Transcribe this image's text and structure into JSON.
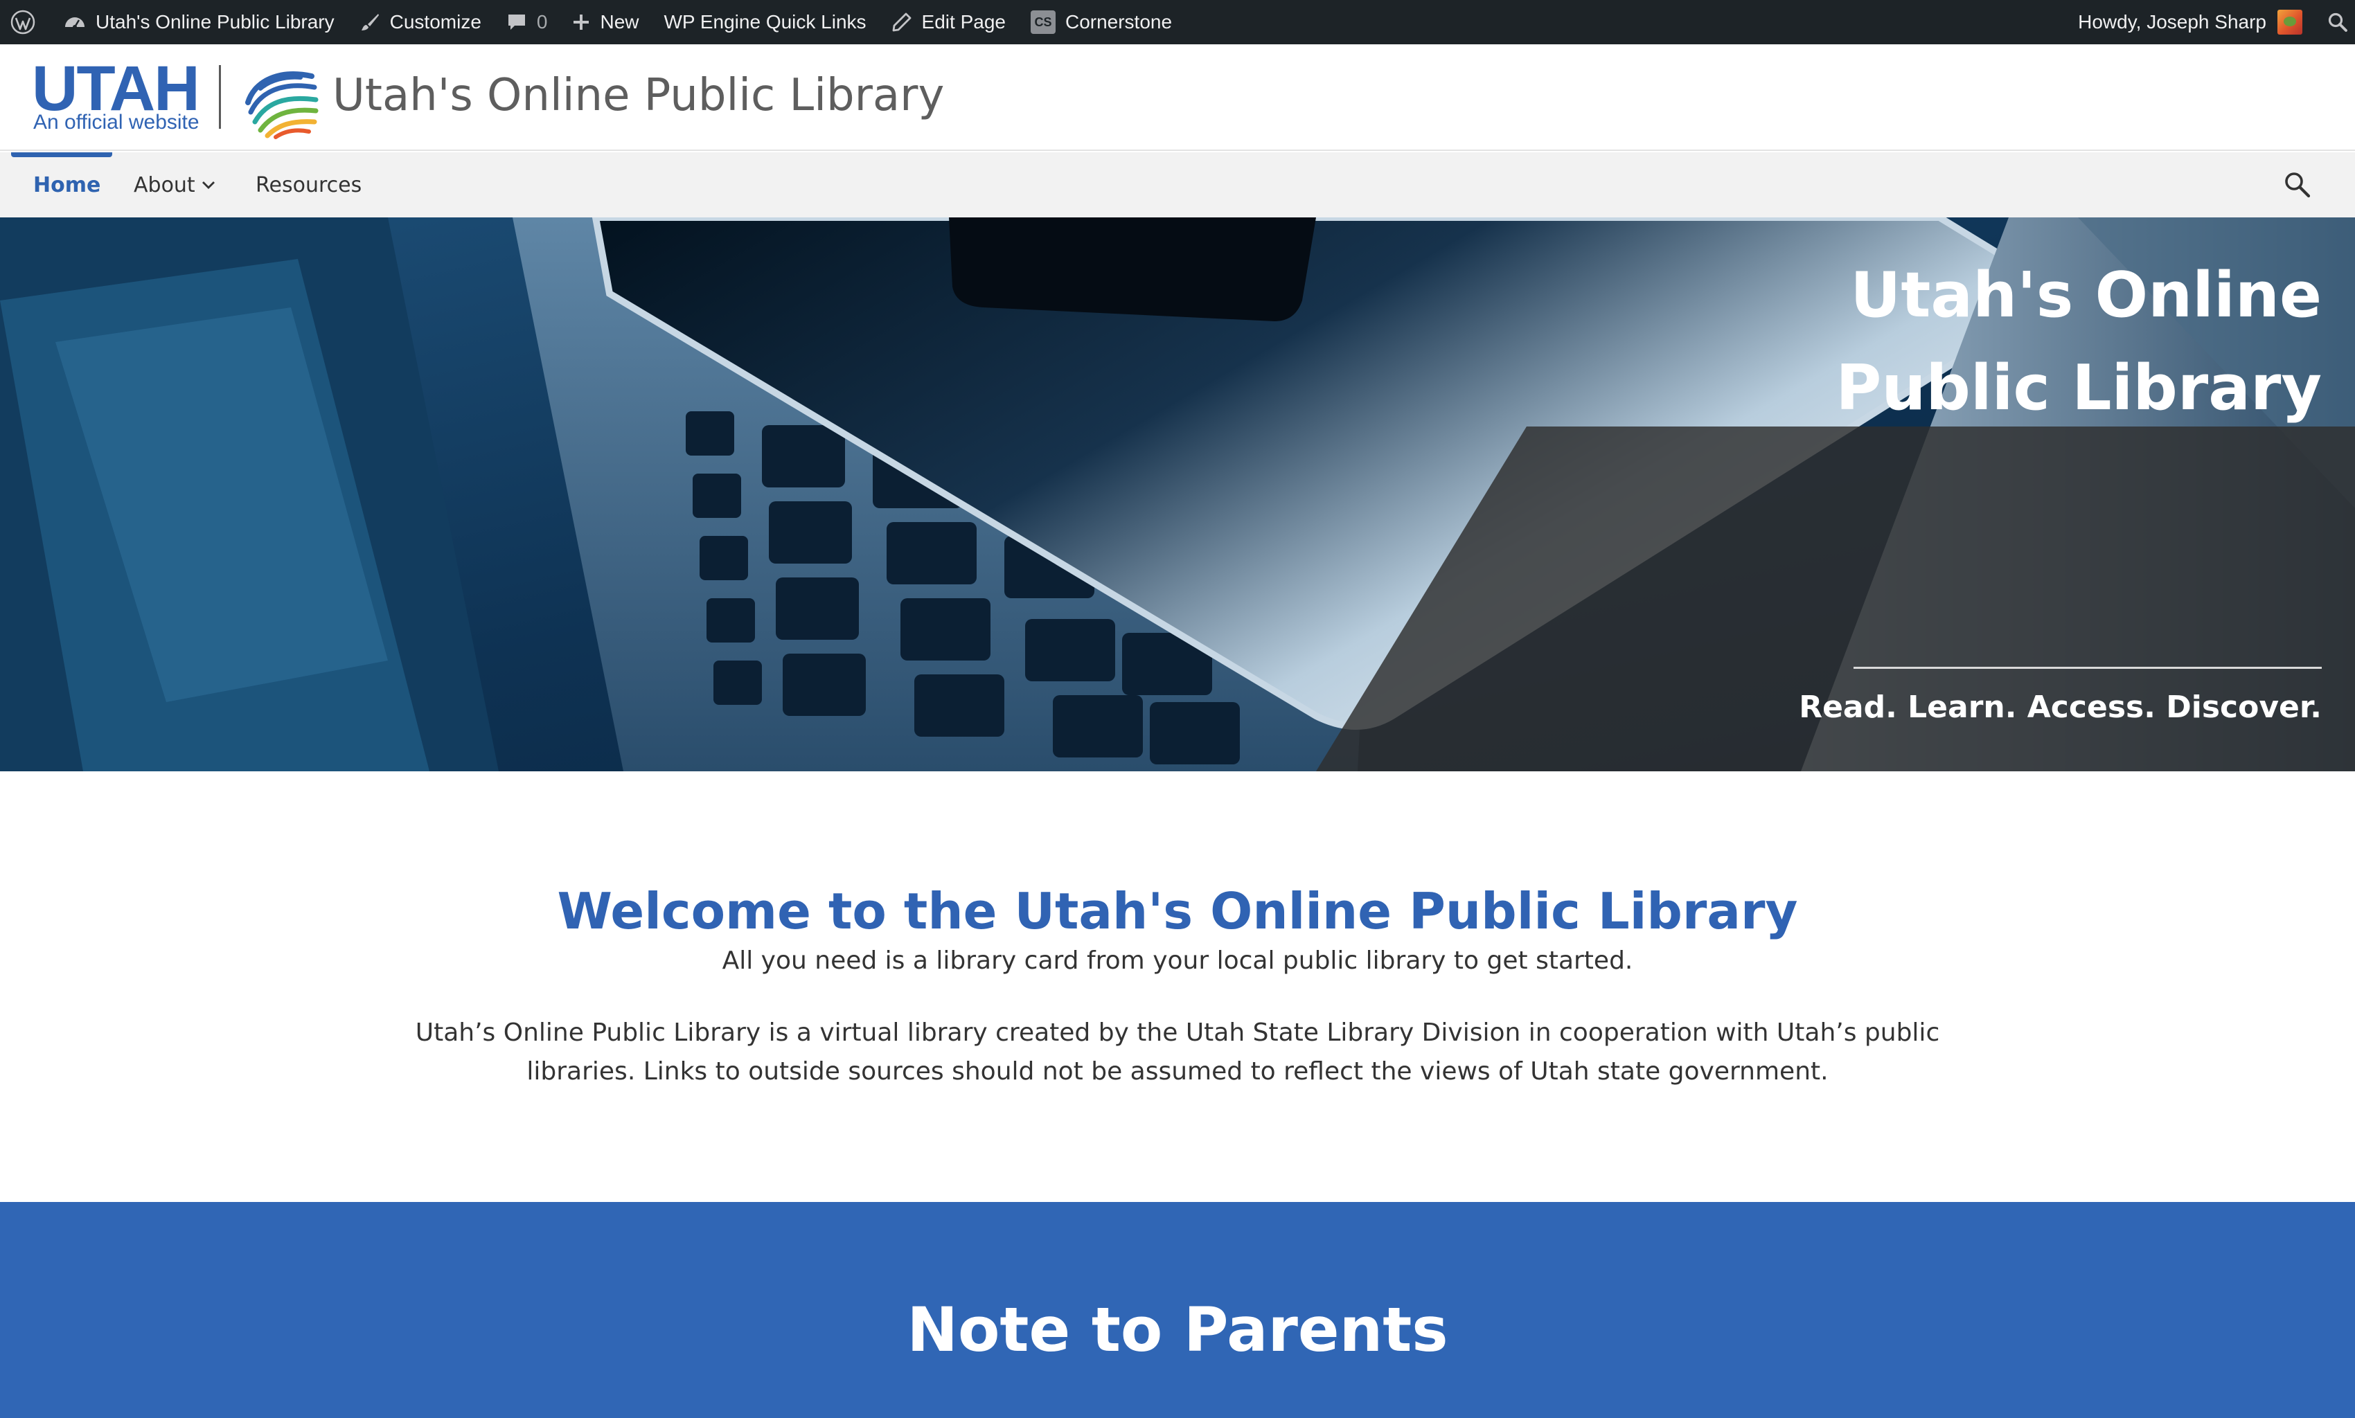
{
  "adminbar": {
    "site_name": "Utah's Online Public Library",
    "customize": "Customize",
    "comments_count": "0",
    "new": "New",
    "quick_links": "WP Engine Quick Links",
    "edit_page": "Edit Page",
    "cornerstone": "Cornerstone",
    "cornerstone_badge": "CS",
    "greeting": "Howdy, Joseph Sharp"
  },
  "header": {
    "utah_wordmark": "UTAH",
    "official_text": "An official website",
    "site_title": "Utah's Online Public Library"
  },
  "nav": {
    "items": [
      {
        "label": "Home",
        "active": true
      },
      {
        "label": "About",
        "has_dropdown": true
      },
      {
        "label": "Resources"
      }
    ],
    "search_icon": "search-icon"
  },
  "hero": {
    "title": "Utah's Online Public Library",
    "tagline": "Read. Learn. Access. Discover."
  },
  "welcome": {
    "title": "Welcome to the Utah's Online Public Library",
    "subtitle": "All you need is a library card from your local public library to get started.",
    "body": "Utah’s Online Public Library is a virtual library created by the Utah State Library Division in cooperation with Utah’s public libraries. Links to outside sources should not be assumed to reflect the views of Utah state government."
  },
  "parents": {
    "title": "Note to Parents"
  },
  "colors": {
    "brand_blue": "#3063b3",
    "admin_bar": "#1d2327",
    "nav_bg": "#f2f2f2",
    "parents_bg": "#3066b5"
  }
}
